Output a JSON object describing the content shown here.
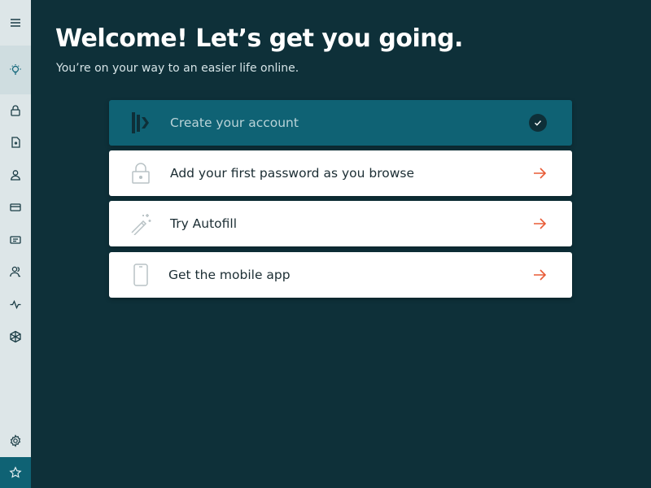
{
  "header": {
    "title": "Welcome! Let’s get you going.",
    "subtitle": "You’re on your way to an easier life online."
  },
  "sidebar": {
    "items": [
      {
        "icon": "menu-icon"
      },
      {
        "icon": "lightbulb-icon",
        "active": true
      },
      {
        "icon": "lock-icon"
      },
      {
        "icon": "secure-note-icon"
      },
      {
        "icon": "person-icon"
      },
      {
        "icon": "credit-card-icon"
      },
      {
        "icon": "id-card-icon"
      },
      {
        "icon": "sharing-icon"
      },
      {
        "icon": "activity-icon"
      },
      {
        "icon": "cube-icon"
      },
      {
        "icon": "gear-icon"
      },
      {
        "icon": "star-icon"
      }
    ]
  },
  "steps": [
    {
      "label": "Create your account",
      "icon": "dashlane-logo-icon",
      "status": "done"
    },
    {
      "label": "Add your first password as you browse",
      "icon": "lock-icon",
      "status": "todo"
    },
    {
      "label": "Try Autofill",
      "icon": "magic-wand-icon",
      "status": "todo"
    },
    {
      "label": "Get the mobile app",
      "icon": "phone-icon",
      "status": "todo"
    }
  ],
  "colors": {
    "background": "#0e3039",
    "sidebar": "#dde6e8",
    "accent": "#0f6274",
    "arrow": "#e85b36"
  }
}
